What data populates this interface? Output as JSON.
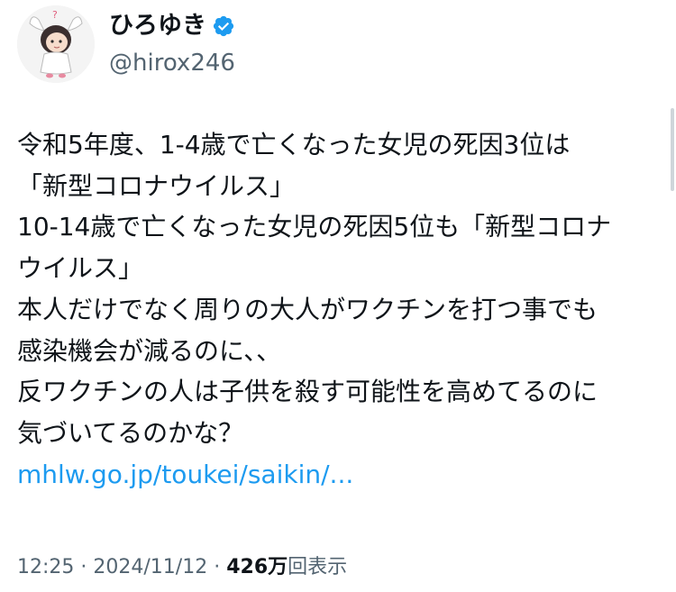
{
  "author": {
    "display_name": "ひろゆき",
    "handle": "@hirox246",
    "verified": true,
    "verified_color": "#1d9bf0",
    "avatar_icon": "avatar-icon",
    "badge_icon": "verified-badge-icon"
  },
  "tweet": {
    "lines": [
      "令和5年度、1-4歳で亡くなった女児の死因3位は",
      "「新型コロナウイルス」",
      "10-14歳で亡くなった女児の死因5位も「新型コロナ",
      "ウイルス」",
      "本人だけでなく周りの大人がワクチンを打つ事でも",
      "感染機会が減るのに、、",
      "反ワクチンの人は子供を殺す可能性を高めてるのに",
      "気づいてるのかな？"
    ],
    "link_text": "mhlw.go.jp/toukei/saikin/..."
  },
  "meta": {
    "time": "12:25",
    "separator": "·",
    "date": "2024/11/12",
    "views_count": "426万",
    "views_label": "回表示"
  },
  "colors": {
    "text": "#0f1419",
    "secondary": "#536471",
    "link": "#1d9bf0"
  }
}
